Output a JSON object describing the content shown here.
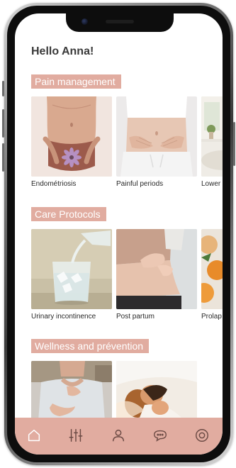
{
  "greeting": "Hello Anna!",
  "sections": [
    {
      "title": "Pain management",
      "cards": [
        {
          "label": "Endométriosis",
          "image": "woman-abdomen-with-flower"
        },
        {
          "label": "Painful periods",
          "image": "hands-on-belly"
        },
        {
          "label": "Lower",
          "image": "bedroom"
        }
      ]
    },
    {
      "title": "Care Protocols",
      "cards": [
        {
          "label": "Urinary incontinence",
          "image": "water-glass"
        },
        {
          "label": "Post partum",
          "image": "baby-feet-on-belly"
        },
        {
          "label": "Prolap",
          "image": "oranges"
        }
      ]
    },
    {
      "title": "Wellness and prévention",
      "cards": [
        {
          "label": "",
          "image": "woman-chest-pain"
        },
        {
          "label": "",
          "image": "couple-in-bed"
        }
      ]
    }
  ],
  "tabbar": {
    "items": [
      {
        "icon": "home-icon",
        "active": true
      },
      {
        "icon": "sliders-icon",
        "active": false
      },
      {
        "icon": "profile-icon",
        "active": false
      },
      {
        "icon": "chat-icon",
        "active": false
      },
      {
        "icon": "settings-icon",
        "active": false
      }
    ]
  },
  "colors": {
    "accent": "#e1aca0",
    "text": "#3a3a3a",
    "tab_icon": "#6b4a44"
  }
}
